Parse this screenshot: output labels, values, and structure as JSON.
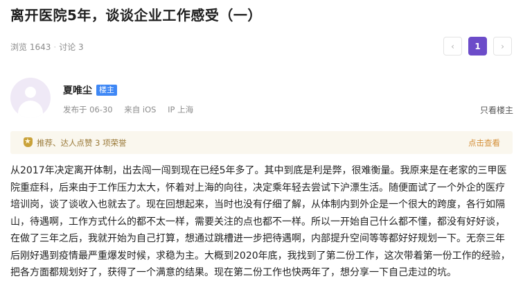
{
  "post": {
    "title": "离开医院5年，谈谈企业工作感受（一）",
    "views": "浏览 1643",
    "comments": "讨论 3"
  },
  "pagination": {
    "prev_icon": "‹",
    "current_page": "1",
    "next_icon": "›"
  },
  "author": {
    "name": "夏唯尘",
    "badge": "楼主",
    "published": "发布于 06-30",
    "source": "来自 iOS",
    "ip": "IP 上海",
    "only_op_label": "只看楼主"
  },
  "honor": {
    "text": "推荐、达人点赞 3 项荣誉",
    "link": "点击查看"
  },
  "content": "从2017年决定离开体制，出去闯一闯到现在已经5年多了。其中到底是利是弊，很难衡量。我原来是在老家的三甲医院重症科，后来由于工作压力太大，怀着对上海的向往，决定乘年轻去尝试下沪漂生活。随便面试了一个外企的医疗培训岗，谈了谈收入也就去了。现在回想起来，当时也没有仔细了解，从体制内到外企是一个很大的跨度，各行如隔山，待遇啊，工作方式什么的都不太一样，需要关注的点也都不一样。所以一开始自己什么都不懂，都没有好好谈，在做了三年之后，我就开始为自己打算，想通过跳槽进一步把待遇啊，内部提升空间等等都好好规划一下。无奈三年后刚好遇到疫情最严重爆发时候，求稳为主。大概到2020年底，我找到了第二份工作，这次带着第一份工作的经验，把各方面都规划好了，获得了一个满意的结果。现在第二份工作也快两年了，想分享一下自己走过的坑。"
}
